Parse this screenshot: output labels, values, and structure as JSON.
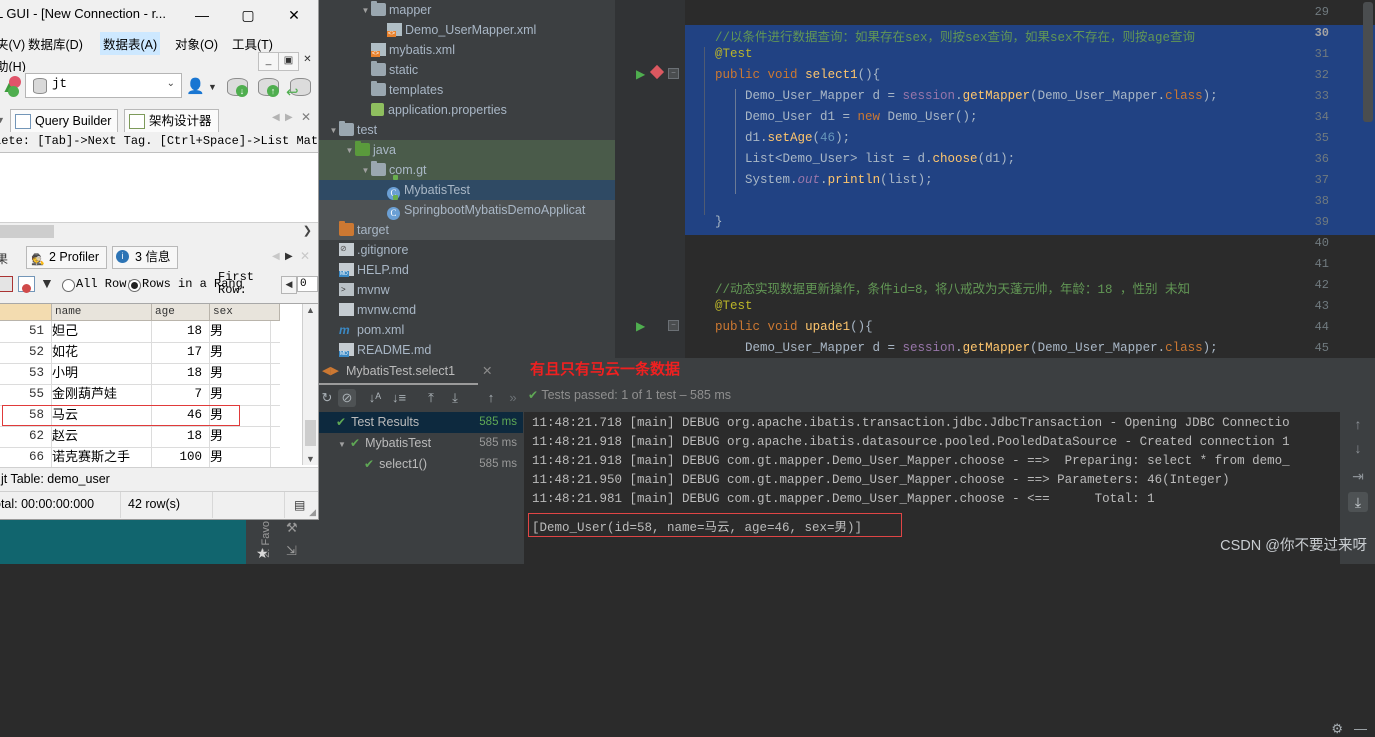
{
  "navicat": {
    "title": "L GUI - [New Connection - r...",
    "window_buttons": [
      "—",
      "▢",
      "✕"
    ],
    "inner_buttons": [
      "_",
      "▣",
      "✕"
    ],
    "menus": [
      {
        "label": "夹(V)"
      },
      {
        "label": "数据库(D)"
      },
      {
        "label": "数据表(A)"
      },
      {
        "label": "对象(O)"
      },
      {
        "label": "工具(T)"
      },
      {
        "label": "助(H)"
      }
    ],
    "db_select": {
      "value": "jt",
      "chevron": "⌄"
    },
    "tabs": [
      {
        "label": "Query Builder",
        "icon": "query-builder-icon"
      },
      {
        "label": "架构设计器",
        "icon": "schema-designer-icon"
      }
    ],
    "tabbar_nav": [
      "◀",
      "▶",
      "✕"
    ],
    "hint": "lete: [Tab]->Next Tag. [Ctrl+Space]->List Matching ...",
    "hscroll_arrow": "❯",
    "result_tabs": [
      {
        "label": "2 Profiler",
        "num": "2",
        "icon": "profiler-icon"
      },
      {
        "label": "3 信息",
        "num": "3",
        "icon": "info-icon"
      }
    ],
    "result_nav": [
      "◀",
      "▶",
      "✕"
    ],
    "grid_toolbar": {
      "all_rows_label": "All Row:",
      "range_label": "Rows in a Rang",
      "first_row_label": "First Row:",
      "first_row_value": "0",
      "selected": "rows_in_a_range"
    },
    "grid": {
      "columns": [
        "name",
        "age",
        "sex"
      ],
      "rows": [
        {
          "id": "51",
          "name": "妲己",
          "age": "18",
          "sex": "男"
        },
        {
          "id": "52",
          "name": "如花",
          "age": "17",
          "sex": "男"
        },
        {
          "id": "53",
          "name": "小明",
          "age": "18",
          "sex": "男"
        },
        {
          "id": "55",
          "name": "金刚葫芦娃",
          "age": "7",
          "sex": "男"
        },
        {
          "id": "58",
          "name": "马云",
          "age": "46",
          "sex": "男"
        },
        {
          "id": "62",
          "name": "赵云",
          "age": "18",
          "sex": "男"
        },
        {
          "id": "66",
          "name": "诺克赛斯之手",
          "age": "100",
          "sex": "男"
        }
      ],
      "highlighted_row_index": 4
    },
    "status_table": ": jt Table: demo_user",
    "status_total": "otal: 00:00:00:000",
    "status_rows": "42 row(s)"
  },
  "ide": {
    "tree": [
      {
        "label": "mapper",
        "icon": "folder-icon",
        "indent": 3,
        "arrow": "▼",
        "state": "none"
      },
      {
        "label": "Demo_UserMapper.xml",
        "icon": "xml-file-icon",
        "indent": 4,
        "arrow": "",
        "state": "none"
      },
      {
        "label": "mybatis.xml",
        "icon": "xml-file-icon",
        "indent": 3,
        "arrow": "",
        "state": "none"
      },
      {
        "label": "static",
        "icon": "folder-icon",
        "indent": 3,
        "arrow": "",
        "state": "none"
      },
      {
        "label": "templates",
        "icon": "folder-icon",
        "indent": 3,
        "arrow": "",
        "state": "none"
      },
      {
        "label": "application.properties",
        "icon": "properties-file-icon",
        "indent": 3,
        "arrow": "",
        "state": "none"
      },
      {
        "label": "test",
        "icon": "folder-icon",
        "indent": 1,
        "arrow": "▼",
        "state": "none"
      },
      {
        "label": "java",
        "icon": "source-folder-icon",
        "indent": 2,
        "arrow": "▼",
        "state": "green"
      },
      {
        "label": "com.gt",
        "icon": "package-icon",
        "indent": 3,
        "arrow": "▼",
        "state": "green"
      },
      {
        "label": "MybatisTest",
        "icon": "java-test-class-icon",
        "indent": 4,
        "arrow": "",
        "state": "blue"
      },
      {
        "label": "SpringbootMybatisDemoApplicat",
        "icon": "java-test-class-icon",
        "indent": 4,
        "arrow": "",
        "state": "grey"
      },
      {
        "label": "target",
        "icon": "folder-orange-icon",
        "indent": 1,
        "arrow": "",
        "state": "grey"
      },
      {
        "label": ".gitignore",
        "icon": "gitignore-file-icon",
        "indent": 1,
        "arrow": "",
        "state": "none"
      },
      {
        "label": "HELP.md",
        "icon": "markdown-file-icon",
        "indent": 1,
        "arrow": "",
        "state": "none"
      },
      {
        "label": "mvnw",
        "icon": "shell-file-icon",
        "indent": 1,
        "arrow": "",
        "state": "none"
      },
      {
        "label": "mvnw.cmd",
        "icon": "text-file-icon",
        "indent": 1,
        "arrow": "",
        "state": "none"
      },
      {
        "label": "pom.xml",
        "icon": "maven-file-icon",
        "indent": 1,
        "arrow": "",
        "state": "none"
      },
      {
        "label": "README.md",
        "icon": "markdown-file-icon",
        "indent": 1,
        "arrow": "",
        "state": "none"
      }
    ],
    "editor": {
      "first_line": 29,
      "current_line": 30,
      "lines": [
        {
          "n": 29,
          "text": ""
        },
        {
          "n": 30,
          "text": "    //以条件进行数据查询：如果存在sex，则按sex查询，如果sex不存在，则按age查询"
        },
        {
          "n": 31,
          "text": "    @Test"
        },
        {
          "n": 32,
          "text": "    public void select1(){"
        },
        {
          "n": 33,
          "text": "        Demo_User_Mapper d = session.getMapper(Demo_User_Mapper.class);"
        },
        {
          "n": 34,
          "text": "        Demo_User d1 = new Demo_User();"
        },
        {
          "n": 35,
          "text": "        d1.setAge(46);"
        },
        {
          "n": 36,
          "text": "        List<Demo_User> list = d.choose(d1);"
        },
        {
          "n": 37,
          "text": "        System.out.println(list);"
        },
        {
          "n": 38,
          "text": ""
        },
        {
          "n": 39,
          "text": "    }"
        },
        {
          "n": 40,
          "text": ""
        },
        {
          "n": 41,
          "text": ""
        },
        {
          "n": 42,
          "text": "    //动态实现数据更新操作，条件id=8，将八戒改为天蓬元帅，年龄：18 ，性别 未知"
        },
        {
          "n": 43,
          "text": "    @Test"
        },
        {
          "n": 44,
          "text": "    public void upade1(){"
        },
        {
          "n": 45,
          "text": "        Demo_User_Mapper d = session.getMapper(Demo_User_Mapper.class);"
        }
      ]
    },
    "run_panel": {
      "tab_label": "MybatisTest.select1",
      "tab_close": "✕",
      "annotation": "有且只有马云一条数据",
      "status": "Tests passed: 1 of 1 test – 585 ms",
      "toolbar_icons": [
        "rerun-icon",
        "suppress-icon",
        "sort-alphabetically-icon",
        "sort-duration-icon",
        "expand-all-icon",
        "collapse-all-icon",
        "prev-test-icon",
        "next-test-icon"
      ],
      "tree": [
        {
          "label": "Test Results",
          "time": "585 ms",
          "indent": 0,
          "arrow": "",
          "selected": true,
          "time_green": true
        },
        {
          "label": "MybatisTest",
          "time": "585 ms",
          "indent": 1,
          "arrow": "▼",
          "selected": false,
          "time_green": false
        },
        {
          "label": "select1()",
          "time": "585 ms",
          "indent": 2,
          "arrow": "",
          "selected": false,
          "time_green": false
        }
      ],
      "console": [
        "11:48:21.718 [main] DEBUG org.apache.ibatis.transaction.jdbc.JdbcTransaction - Opening JDBC Connectio",
        "11:48:21.918 [main] DEBUG org.apache.ibatis.datasource.pooled.PooledDataSource - Created connection 1",
        "11:48:21.918 [main] DEBUG com.gt.mapper.Demo_User_Mapper.choose - ==>  Preparing: select * from demo_",
        "11:48:21.950 [main] DEBUG com.gt.mapper.Demo_User_Mapper.choose - ==> Parameters: 46(Integer)",
        "11:48:21.981 [main] DEBUG com.gt.mapper.Demo_User_Mapper.choose - <==      Total: 1"
      ],
      "result": "[Demo_User(id=58, name=马云, age=46, sex=男)]",
      "side_buttons": [
        "up-arrow-icon",
        "down-arrow-icon",
        "soft-wrap-icon",
        "scroll-to-end-icon"
      ],
      "gear": "⚙",
      "minimize": "—"
    },
    "left_strip_label": "2: Favo"
  },
  "watermark": "CSDN @你不要过来呀",
  "colors": {
    "ide_bg": "#3c3f41",
    "editor_bg": "#2b2b2b",
    "selection": "#214283",
    "comment": "#629755",
    "keyword": "#cc7832",
    "annotation_red": "#f02020",
    "pass_green": "#5fa855"
  }
}
